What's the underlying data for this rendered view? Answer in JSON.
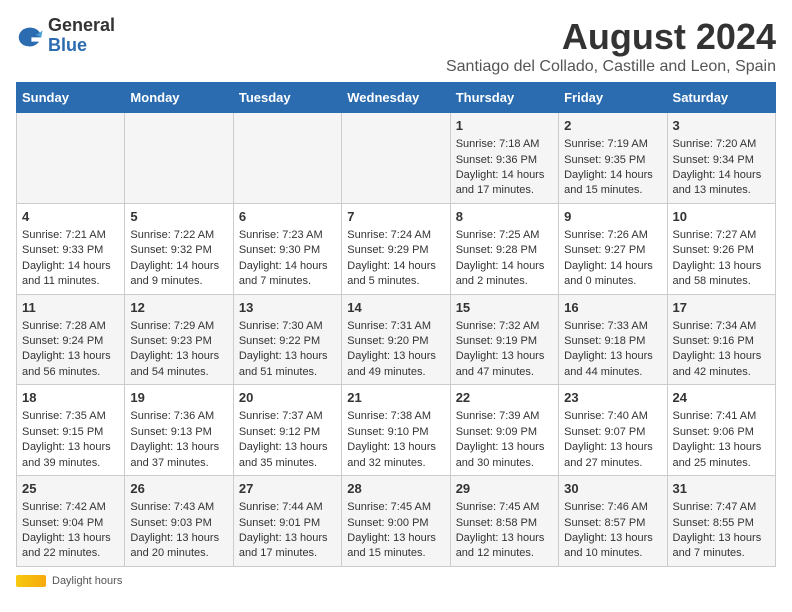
{
  "logo": {
    "general": "General",
    "blue": "Blue"
  },
  "title": "August 2024",
  "subtitle": "Santiago del Collado, Castille and Leon, Spain",
  "days_header": [
    "Sunday",
    "Monday",
    "Tuesday",
    "Wednesday",
    "Thursday",
    "Friday",
    "Saturday"
  ],
  "weeks": [
    [
      {
        "day": "",
        "info": ""
      },
      {
        "day": "",
        "info": ""
      },
      {
        "day": "",
        "info": ""
      },
      {
        "day": "",
        "info": ""
      },
      {
        "day": "1",
        "info": "Sunrise: 7:18 AM\nSunset: 9:36 PM\nDaylight: 14 hours and 17 minutes."
      },
      {
        "day": "2",
        "info": "Sunrise: 7:19 AM\nSunset: 9:35 PM\nDaylight: 14 hours and 15 minutes."
      },
      {
        "day": "3",
        "info": "Sunrise: 7:20 AM\nSunset: 9:34 PM\nDaylight: 14 hours and 13 minutes."
      }
    ],
    [
      {
        "day": "4",
        "info": "Sunrise: 7:21 AM\nSunset: 9:33 PM\nDaylight: 14 hours and 11 minutes."
      },
      {
        "day": "5",
        "info": "Sunrise: 7:22 AM\nSunset: 9:32 PM\nDaylight: 14 hours and 9 minutes."
      },
      {
        "day": "6",
        "info": "Sunrise: 7:23 AM\nSunset: 9:30 PM\nDaylight: 14 hours and 7 minutes."
      },
      {
        "day": "7",
        "info": "Sunrise: 7:24 AM\nSunset: 9:29 PM\nDaylight: 14 hours and 5 minutes."
      },
      {
        "day": "8",
        "info": "Sunrise: 7:25 AM\nSunset: 9:28 PM\nDaylight: 14 hours and 2 minutes."
      },
      {
        "day": "9",
        "info": "Sunrise: 7:26 AM\nSunset: 9:27 PM\nDaylight: 14 hours and 0 minutes."
      },
      {
        "day": "10",
        "info": "Sunrise: 7:27 AM\nSunset: 9:26 PM\nDaylight: 13 hours and 58 minutes."
      }
    ],
    [
      {
        "day": "11",
        "info": "Sunrise: 7:28 AM\nSunset: 9:24 PM\nDaylight: 13 hours and 56 minutes."
      },
      {
        "day": "12",
        "info": "Sunrise: 7:29 AM\nSunset: 9:23 PM\nDaylight: 13 hours and 54 minutes."
      },
      {
        "day": "13",
        "info": "Sunrise: 7:30 AM\nSunset: 9:22 PM\nDaylight: 13 hours and 51 minutes."
      },
      {
        "day": "14",
        "info": "Sunrise: 7:31 AM\nSunset: 9:20 PM\nDaylight: 13 hours and 49 minutes."
      },
      {
        "day": "15",
        "info": "Sunrise: 7:32 AM\nSunset: 9:19 PM\nDaylight: 13 hours and 47 minutes."
      },
      {
        "day": "16",
        "info": "Sunrise: 7:33 AM\nSunset: 9:18 PM\nDaylight: 13 hours and 44 minutes."
      },
      {
        "day": "17",
        "info": "Sunrise: 7:34 AM\nSunset: 9:16 PM\nDaylight: 13 hours and 42 minutes."
      }
    ],
    [
      {
        "day": "18",
        "info": "Sunrise: 7:35 AM\nSunset: 9:15 PM\nDaylight: 13 hours and 39 minutes."
      },
      {
        "day": "19",
        "info": "Sunrise: 7:36 AM\nSunset: 9:13 PM\nDaylight: 13 hours and 37 minutes."
      },
      {
        "day": "20",
        "info": "Sunrise: 7:37 AM\nSunset: 9:12 PM\nDaylight: 13 hours and 35 minutes."
      },
      {
        "day": "21",
        "info": "Sunrise: 7:38 AM\nSunset: 9:10 PM\nDaylight: 13 hours and 32 minutes."
      },
      {
        "day": "22",
        "info": "Sunrise: 7:39 AM\nSunset: 9:09 PM\nDaylight: 13 hours and 30 minutes."
      },
      {
        "day": "23",
        "info": "Sunrise: 7:40 AM\nSunset: 9:07 PM\nDaylight: 13 hours and 27 minutes."
      },
      {
        "day": "24",
        "info": "Sunrise: 7:41 AM\nSunset: 9:06 PM\nDaylight: 13 hours and 25 minutes."
      }
    ],
    [
      {
        "day": "25",
        "info": "Sunrise: 7:42 AM\nSunset: 9:04 PM\nDaylight: 13 hours and 22 minutes."
      },
      {
        "day": "26",
        "info": "Sunrise: 7:43 AM\nSunset: 9:03 PM\nDaylight: 13 hours and 20 minutes."
      },
      {
        "day": "27",
        "info": "Sunrise: 7:44 AM\nSunset: 9:01 PM\nDaylight: 13 hours and 17 minutes."
      },
      {
        "day": "28",
        "info": "Sunrise: 7:45 AM\nSunset: 9:00 PM\nDaylight: 13 hours and 15 minutes."
      },
      {
        "day": "29",
        "info": "Sunrise: 7:45 AM\nSunset: 8:58 PM\nDaylight: 13 hours and 12 minutes."
      },
      {
        "day": "30",
        "info": "Sunrise: 7:46 AM\nSunset: 8:57 PM\nDaylight: 13 hours and 10 minutes."
      },
      {
        "day": "31",
        "info": "Sunrise: 7:47 AM\nSunset: 8:55 PM\nDaylight: 13 hours and 7 minutes."
      }
    ]
  ],
  "footer": {
    "daylight_label": "Daylight hours"
  }
}
